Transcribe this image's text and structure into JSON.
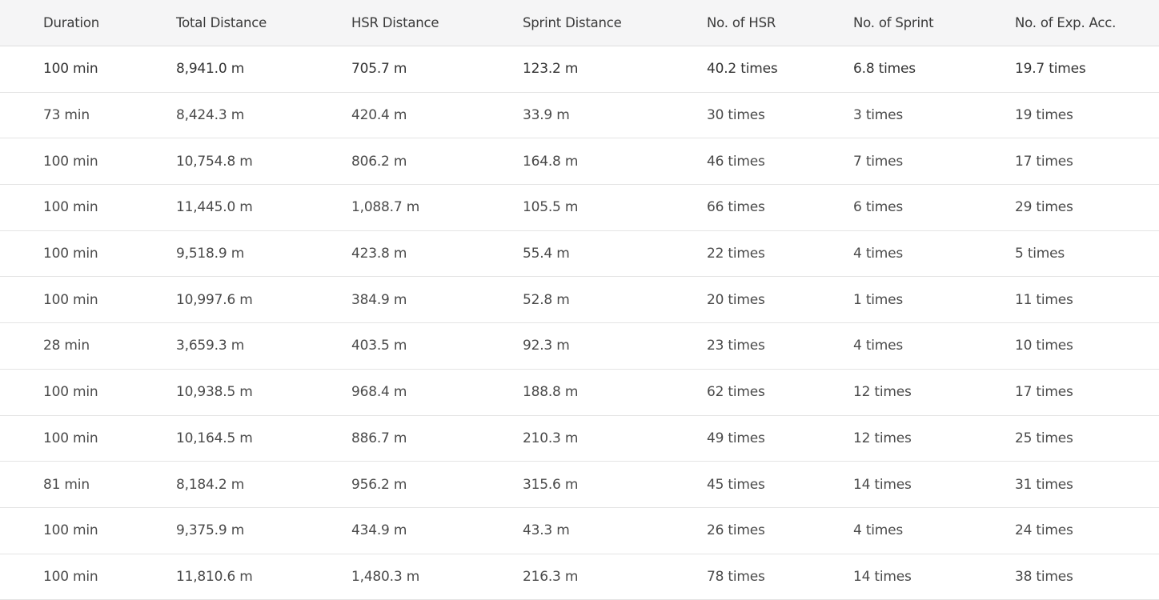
{
  "table": {
    "columns": [
      "Duration",
      "Total Distance",
      "HSR Distance",
      "Sprint Distance",
      "No. of HSR",
      "No. of Sprint",
      "No. of Exp. Acc."
    ],
    "rows": [
      [
        "100 min",
        "8,941.0 m",
        "705.7 m",
        "123.2 m",
        "40.2 times",
        "6.8 times",
        "19.7 times"
      ],
      [
        "73 min",
        "8,424.3 m",
        "420.4 m",
        "33.9 m",
        "30 times",
        "3 times",
        "19 times"
      ],
      [
        "100 min",
        "10,754.8 m",
        "806.2 m",
        "164.8 m",
        "46 times",
        "7 times",
        "17 times"
      ],
      [
        "100 min",
        "11,445.0 m",
        "1,088.7 m",
        "105.5 m",
        "66 times",
        "6 times",
        "29 times"
      ],
      [
        "100 min",
        "9,518.9 m",
        "423.8 m",
        "55.4 m",
        "22 times",
        "4 times",
        "5 times"
      ],
      [
        "100 min",
        "10,997.6 m",
        "384.9 m",
        "52.8 m",
        "20 times",
        "1 times",
        "11 times"
      ],
      [
        "28 min",
        "3,659.3 m",
        "403.5 m",
        "92.3 m",
        "23 times",
        "4 times",
        "10 times"
      ],
      [
        "100 min",
        "10,938.5 m",
        "968.4 m",
        "188.8 m",
        "62 times",
        "12 times",
        "17 times"
      ],
      [
        "100 min",
        "10,164.5 m",
        "886.7 m",
        "210.3 m",
        "49 times",
        "12 times",
        "25 times"
      ],
      [
        "81 min",
        "8,184.2 m",
        "956.2 m",
        "315.6 m",
        "45 times",
        "14 times",
        "31 times"
      ],
      [
        "100 min",
        "9,375.9 m",
        "434.9 m",
        "43.3 m",
        "26 times",
        "4 times",
        "24 times"
      ],
      [
        "100 min",
        "11,810.6 m",
        "1,480.3 m",
        "216.3 m",
        "78 times",
        "14 times",
        "38 times"
      ]
    ]
  }
}
